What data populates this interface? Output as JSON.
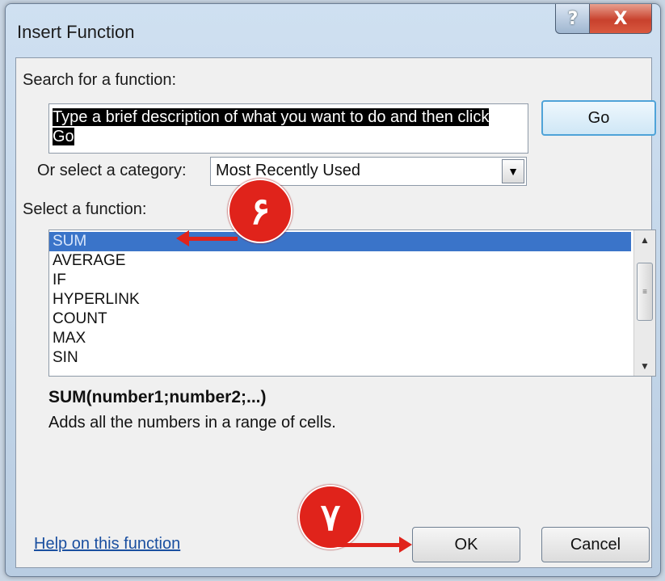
{
  "window": {
    "title": "Insert Function",
    "help_glyph": "?",
    "close_glyph": "X"
  },
  "search": {
    "label": "Search for a function:",
    "value": "Type a brief description of what you want to do and then click Go",
    "go_label": "Go"
  },
  "category": {
    "label": "Or select a category:",
    "selected": "Most Recently Used",
    "arrow_glyph": "▼"
  },
  "functions": {
    "label": "Select a function:",
    "items": [
      "SUM",
      "AVERAGE",
      "IF",
      "HYPERLINK",
      "COUNT",
      "MAX",
      "SIN"
    ],
    "selected_index": 0
  },
  "details": {
    "syntax": "SUM(number1;number2;...)",
    "description": "Adds all the numbers in a range of cells."
  },
  "footer": {
    "help_link": "Help on this function",
    "ok_label": "OK",
    "cancel_label": "Cancel"
  },
  "annotations": {
    "marker_6": "۶",
    "marker_7": "۷",
    "color": "#e0231b"
  },
  "colors": {
    "selection": "#3a74c9",
    "go_border": "#4fa3d8",
    "close_red": "#c8412d"
  }
}
